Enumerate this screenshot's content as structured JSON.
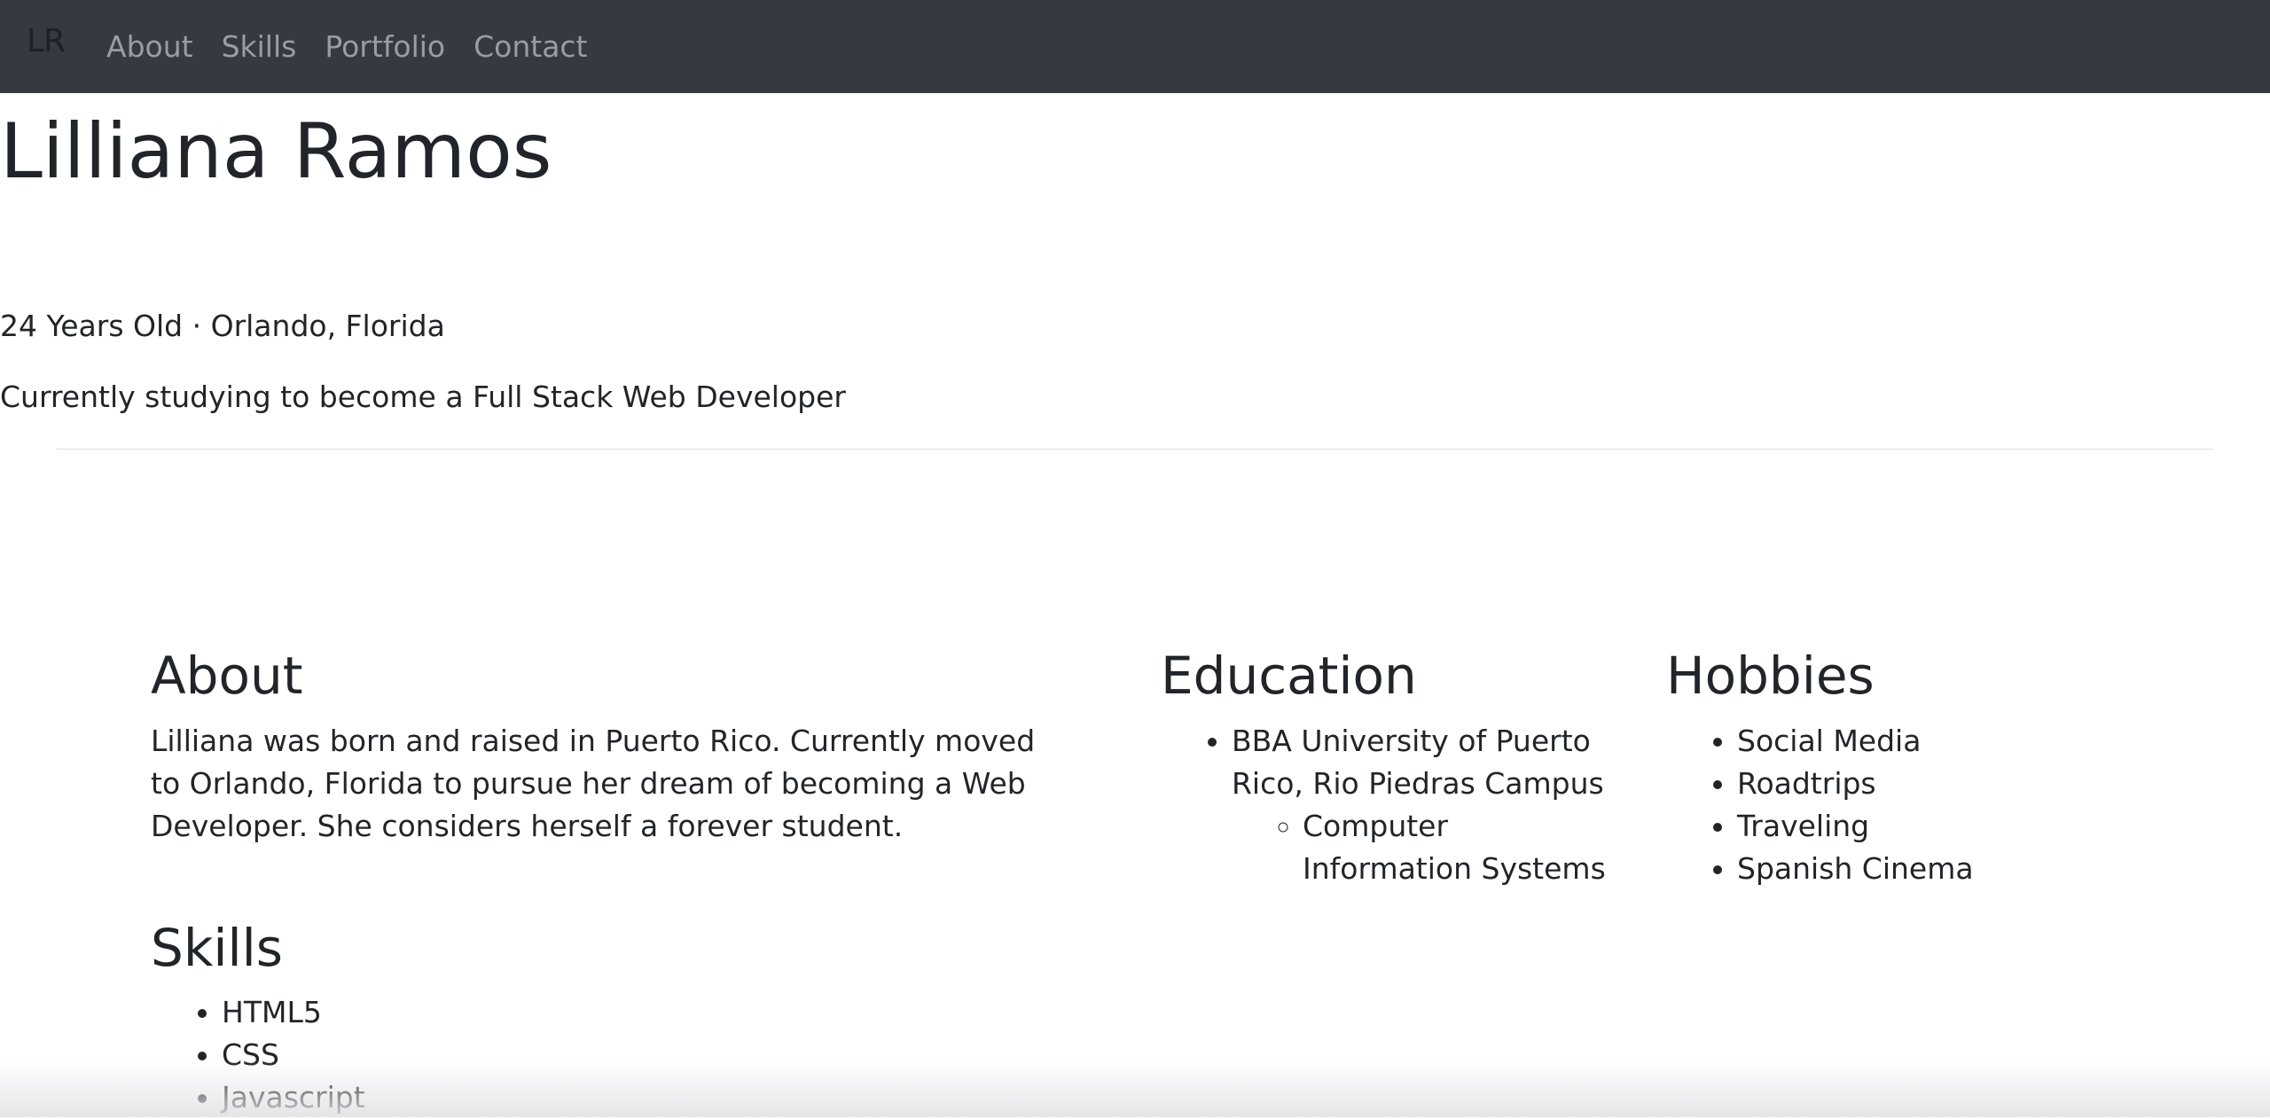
{
  "nav": {
    "brand": "LR",
    "links": [
      {
        "label": "About"
      },
      {
        "label": "Skills"
      },
      {
        "label": "Portfolio"
      },
      {
        "label": "Contact"
      }
    ]
  },
  "hero": {
    "name": "Lilliana Ramos",
    "meta": "24 Years Old · Orlando, Florida",
    "tagline": "Currently studying to become a Full Stack Web Developer"
  },
  "about": {
    "title": "About",
    "text": "Lilliana was born and raised in Puerto Rico. Currently moved to Orlando, Florida to pursue her dream of becoming a Web Developer. She considers herself a forever student."
  },
  "education": {
    "title": "Education",
    "items": [
      {
        "label": "BBA University of Puerto Rico, Rio Piedras Campus",
        "sub": [
          "Computer Information Systems"
        ]
      }
    ]
  },
  "hobbies": {
    "title": "Hobbies",
    "items": [
      "Social Media",
      "Roadtrips",
      "Traveling",
      "Spanish Cinema"
    ]
  },
  "skills": {
    "title": "Skills",
    "items": [
      "HTML5",
      "CSS",
      "Javascript"
    ]
  }
}
